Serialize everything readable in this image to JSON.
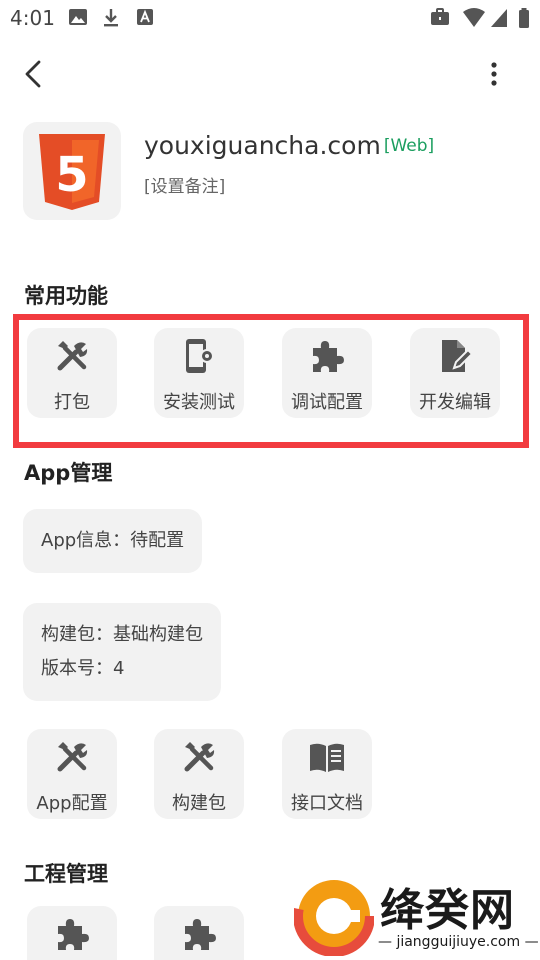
{
  "status_bar": {
    "time": "4:01"
  },
  "app": {
    "name": "youxiguancha.com",
    "tag": "[Web]",
    "remark": "[设置备注]",
    "icon": "html5-icon",
    "icon_label": "5"
  },
  "common_functions": {
    "title": "常用功能",
    "items": [
      {
        "label": "打包",
        "icon": "tools-icon"
      },
      {
        "label": "安装测试",
        "icon": "phone-settings-icon"
      },
      {
        "label": "调试配置",
        "icon": "puzzle-icon"
      },
      {
        "label": "开发编辑",
        "icon": "edit-document-icon"
      }
    ]
  },
  "app_management": {
    "title": "App管理",
    "info": "App信息：待配置",
    "build_package": "构建包：基础构建包",
    "version": "版本号：4",
    "items": [
      {
        "label": "App配置",
        "icon": "tools-icon"
      },
      {
        "label": "构建包",
        "icon": "tools-icon"
      },
      {
        "label": "接口文档",
        "icon": "book-icon"
      }
    ]
  },
  "project_management": {
    "title": "工程管理",
    "items": [
      {
        "icon": "puzzle-icon"
      },
      {
        "icon": "puzzle-icon"
      }
    ]
  },
  "watermark": {
    "text": "绛癸网",
    "url": "— jiangguijiuye.com —"
  },
  "colors": {
    "accent_highlight": "#f23b3f",
    "tag_green": "#1b9e5f",
    "tile_bg": "#f2f2f2",
    "icon_gray": "#555555",
    "html5_orange": "#e44d26"
  }
}
